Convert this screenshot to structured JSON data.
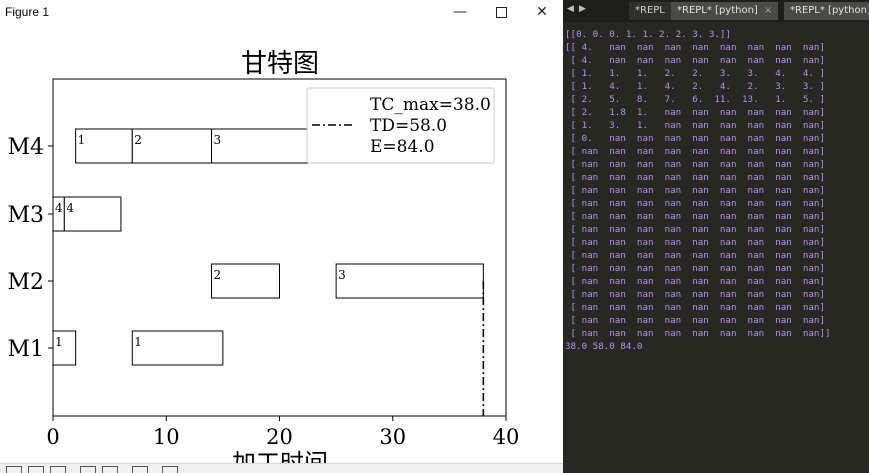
{
  "figure_window": {
    "title": "Figure 1",
    "minimize": "—",
    "close": "✕"
  },
  "chart_data": {
    "type": "gantt",
    "title": "甘特图",
    "xlabel": "加工时间",
    "xlim": [
      0,
      40
    ],
    "xticks": [
      0,
      10,
      20,
      30,
      40
    ],
    "machines": [
      "M1",
      "M2",
      "M3",
      "M4"
    ],
    "tasks": [
      {
        "machine": "M1",
        "job": "1",
        "start": 0,
        "end": 2
      },
      {
        "machine": "M1",
        "job": "1",
        "start": 7,
        "end": 15
      },
      {
        "machine": "M2",
        "job": "2",
        "start": 14,
        "end": 20
      },
      {
        "machine": "M2",
        "job": "3",
        "start": 25,
        "end": 38
      },
      {
        "machine": "M3",
        "job": "4",
        "start": 0,
        "end": 1
      },
      {
        "machine": "M3",
        "job": "4",
        "start": 1,
        "end": 6
      },
      {
        "machine": "M4",
        "job": "1",
        "start": 2,
        "end": 7
      },
      {
        "machine": "M4",
        "job": "2",
        "start": 7,
        "end": 14
      },
      {
        "machine": "M4",
        "job": "3",
        "start": 14,
        "end": 27
      }
    ],
    "tc_max_line": 38.0,
    "legend": {
      "position": "upper-right",
      "entries": [
        "TC_max=38.0",
        "TD=58.0",
        "E=84.0"
      ]
    }
  },
  "repl": {
    "tabs": [
      {
        "label": "*REPL"
      },
      {
        "label": "*REPL* [python]",
        "close": "×"
      },
      {
        "label": "*REPL* [python]"
      }
    ],
    "output_lines": [
      "[[0. 0. 0. 1. 1. 2. 2. 3. 3.]]",
      "[[ 4.   nan  nan  nan  nan  nan  nan  nan  nan]",
      " [ 4.   nan  nan  nan  nan  nan  nan  nan  nan]",
      " [ 1.   1.   1.   2.   2.   3.   3.   4.   4. ]",
      " [ 1.   4.   1.   4.   2.   4.   2.   3.   3. ]",
      " [ 2.   5.   8.   7.   6.  11.  13.   1.   5. ]",
      " [ 2.   1.8  1.   nan  nan  nan  nan  nan  nan]",
      " [ 1.   3.   1.   nan  nan  nan  nan  nan  nan]",
      " [ 0.   nan  nan  nan  nan  nan  nan  nan  nan]",
      " [ nan  nan  nan  nan  nan  nan  nan  nan  nan]",
      " [ nan  nan  nan  nan  nan  nan  nan  nan  nan]",
      " [ nan  nan  nan  nan  nan  nan  nan  nan  nan]",
      " [ nan  nan  nan  nan  nan  nan  nan  nan  nan]",
      " [ nan  nan  nan  nan  nan  nan  nan  nan  nan]",
      " [ nan  nan  nan  nan  nan  nan  nan  nan  nan]",
      " [ nan  nan  nan  nan  nan  nan  nan  nan  nan]",
      " [ nan  nan  nan  nan  nan  nan  nan  nan  nan]",
      " [ nan  nan  nan  nan  nan  nan  nan  nan  nan]",
      " [ nan  nan  nan  nan  nan  nan  nan  nan  nan]",
      " [ nan  nan  nan  nan  nan  nan  nan  nan  nan]",
      " [ nan  nan  nan  nan  nan  nan  nan  nan  nan]",
      " [ nan  nan  nan  nan  nan  nan  nan  nan  nan]",
      " [ nan  nan  nan  nan  nan  nan  nan  nan  nan]",
      " [ nan  nan  nan  nan  nan  nan  nan  nan  nan]]",
      "38.0 58.0 84.0"
    ]
  }
}
